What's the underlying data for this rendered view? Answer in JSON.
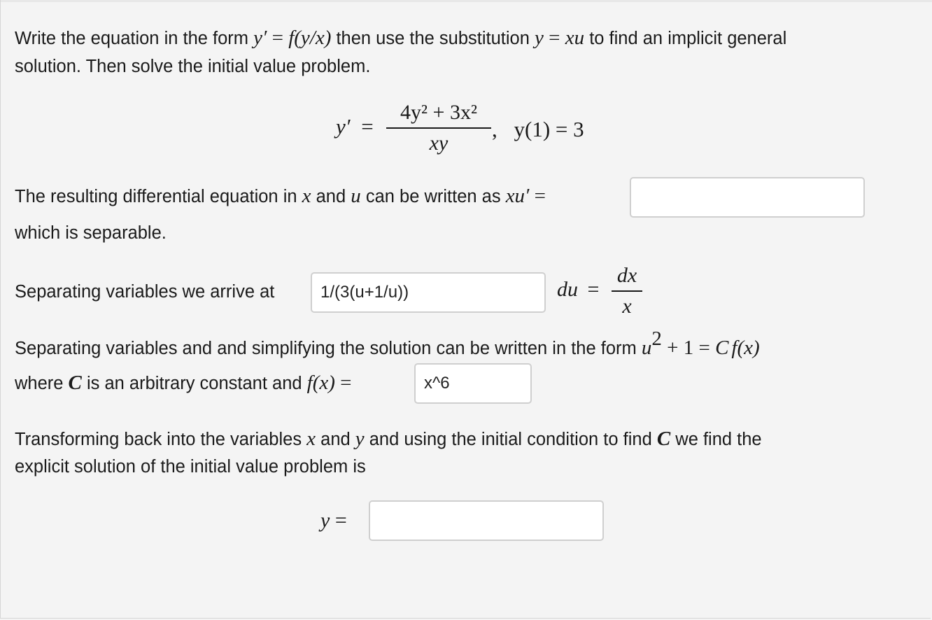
{
  "intro": {
    "part1": "Write the equation in the form ",
    "yprime": "y′",
    "eq1": " = ",
    "fyx": "f(y/x)",
    "part2": " then use the substitution ",
    "y": "y",
    "eq2": " = ",
    "xu": "xu",
    "part3": " to find an implicit general",
    "line2": "solution. Then solve the initial value problem."
  },
  "equation": {
    "lhs": "y′",
    "equals": "=",
    "numerator": "4y² + 3x²",
    "denominator": "xy",
    "comma": ",",
    "ivp": "y(1) = 3"
  },
  "step1": {
    "part1": "The resulting differential equation in ",
    "x": "x",
    "and": " and ",
    "u": "u",
    "part2": " can be written as ",
    "lhs": "xu′",
    "equals": " =",
    "line2": "which is separable.",
    "answer_value": ""
  },
  "step2": {
    "label": "Separating variables we arrive at",
    "answer_value": "1/(3(u+1/u))",
    "du": "du",
    "equals": "=",
    "frac_num": "dx",
    "frac_den": "x"
  },
  "step3": {
    "part1": "Separating variables and and simplifying the solution can be written in the form ",
    "u": "u",
    "rest": " + 1 = ",
    "C": "C",
    "fx": "f(x)",
    "where": "where ",
    "C2": "C",
    "part2": " is an arbitrary constant and ",
    "fx2": "f(x)",
    "equals": " =",
    "answer_value": "x^6"
  },
  "step4": {
    "part1": "Transforming back into the variables ",
    "x": "x",
    "and": " and ",
    "y": "y",
    "part2": " and using the initial condition to find ",
    "C": "C",
    "part3": " we find the",
    "line2": "explicit solution of the initial value problem is",
    "lhs": "y",
    "equals": " =",
    "answer_value": ""
  }
}
